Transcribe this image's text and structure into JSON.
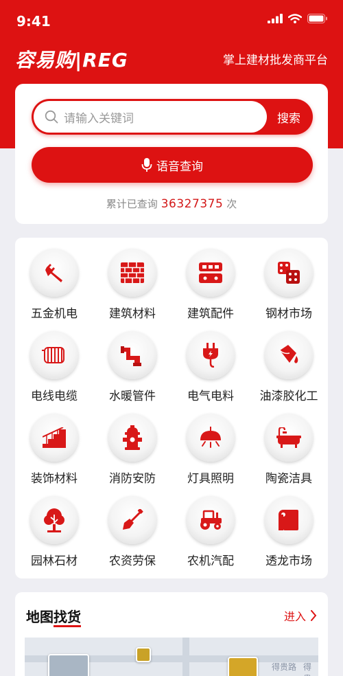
{
  "status_bar": {
    "time": "9:41"
  },
  "header": {
    "brand": "容易购|REG",
    "slogan": "掌上建材批发商平台"
  },
  "search": {
    "placeholder": "请输入关键词",
    "button": "搜索"
  },
  "voice": {
    "label": "语音查询"
  },
  "counter": {
    "prefix": "累计已查询",
    "count": "36327375",
    "suffix": "次"
  },
  "categories": [
    {
      "label": "五金机电",
      "icon": "wrench-icon"
    },
    {
      "label": "建筑材料",
      "icon": "brick-wall-icon"
    },
    {
      "label": "建筑配件",
      "icon": "building-parts-icon"
    },
    {
      "label": "钢材市场",
      "icon": "steel-dice-icon"
    },
    {
      "label": "电线电缆",
      "icon": "cable-coil-icon"
    },
    {
      "label": "水暖管件",
      "icon": "pipe-fitting-icon"
    },
    {
      "label": "电气电料",
      "icon": "electric-plug-icon"
    },
    {
      "label": "油漆胶化工",
      "icon": "paint-bucket-icon"
    },
    {
      "label": "装饰材料",
      "icon": "staircase-icon"
    },
    {
      "label": "消防安防",
      "icon": "fire-hydrant-icon"
    },
    {
      "label": "灯具照明",
      "icon": "ceiling-lamp-icon"
    },
    {
      "label": "陶瓷洁具",
      "icon": "bathtub-icon"
    },
    {
      "label": "园林石材",
      "icon": "tree-icon"
    },
    {
      "label": "农资劳保",
      "icon": "shovel-icon"
    },
    {
      "label": "农机汽配",
      "icon": "tractor-icon"
    },
    {
      "label": "透龙市场",
      "icon": "paper-roll-icon"
    }
  ],
  "map": {
    "title_plain": "地图",
    "title_highlight": "找货",
    "enter": "进入",
    "street_label": "得贵路",
    "street_label2": "得贵"
  },
  "colors": {
    "brand_red": "#dd1212",
    "background": "#eeeef3"
  }
}
